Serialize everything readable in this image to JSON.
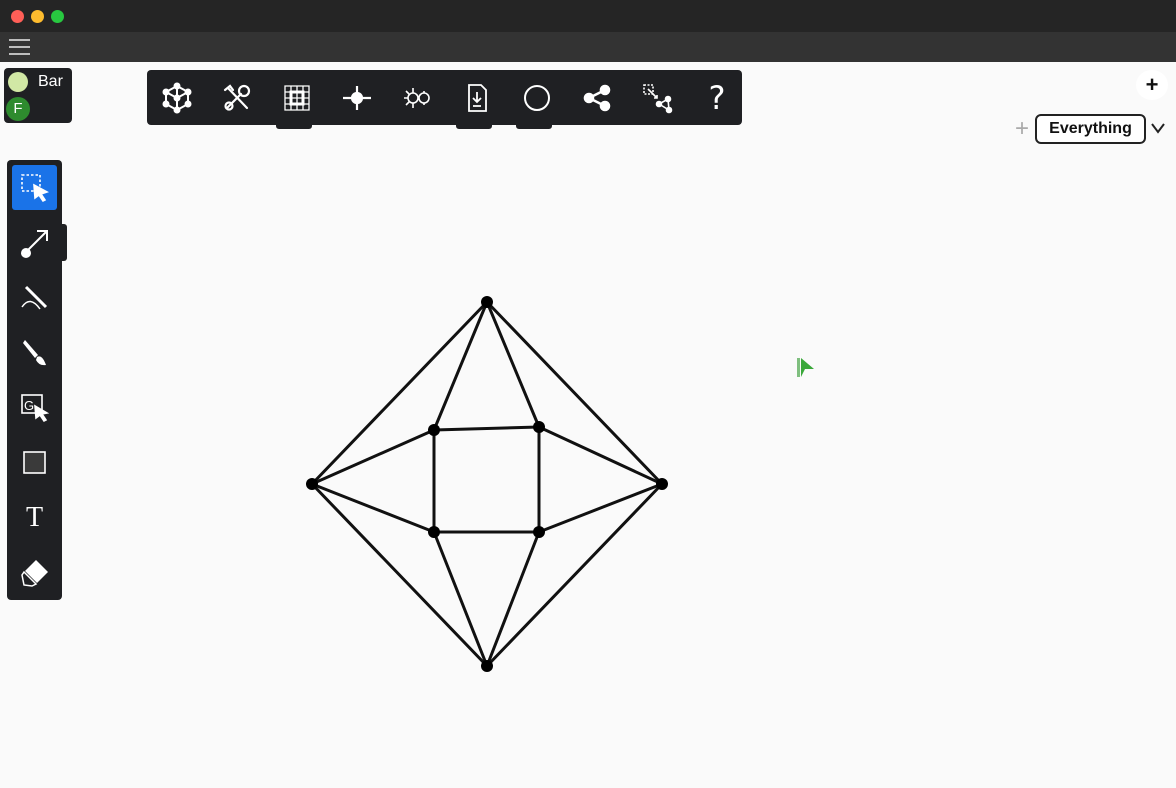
{
  "window": {
    "traffic_lights": [
      {
        "name": "close",
        "color": "#ff5f57"
      },
      {
        "name": "minimize",
        "color": "#febc2e"
      },
      {
        "name": "zoom",
        "color": "#28c840"
      }
    ]
  },
  "menu": {
    "icon": "hamburger-menu-icon"
  },
  "user": {
    "name": "Bar",
    "dot_color": "#d1e8a5",
    "badge_letter": "F",
    "badge_color": "#2e8b2e"
  },
  "toolbar": {
    "tools": [
      {
        "name": "graph-library-icon"
      },
      {
        "name": "tools-icon"
      },
      {
        "name": "grid-icon"
      },
      {
        "name": "vertex-icon"
      },
      {
        "name": "layout-icon"
      },
      {
        "name": "export-file-icon"
      },
      {
        "name": "circle-icon"
      },
      {
        "name": "share-icon"
      },
      {
        "name": "transform-icon"
      },
      {
        "name": "help-icon",
        "label": "?"
      }
    ]
  },
  "add_button_label": "+",
  "filter": {
    "add_label": "+",
    "selected": "Everything"
  },
  "sidebar": {
    "tools": [
      {
        "name": "select-tool-icon",
        "active": true
      },
      {
        "name": "edge-tool-icon"
      },
      {
        "name": "curve-tool-icon"
      },
      {
        "name": "brush-tool-icon"
      },
      {
        "name": "group-select-tool-icon"
      },
      {
        "name": "rectangle-tool-icon"
      },
      {
        "name": "text-tool-icon",
        "label": "T"
      },
      {
        "name": "eraser-tool-icon"
      }
    ]
  },
  "graph": {
    "vertex_count": 8,
    "edge_count": 16
  },
  "colors": {
    "accent": "#1a73e8",
    "panel": "#1f2023",
    "canvas": "#fafafa",
    "cursor": "#3aa83a"
  }
}
